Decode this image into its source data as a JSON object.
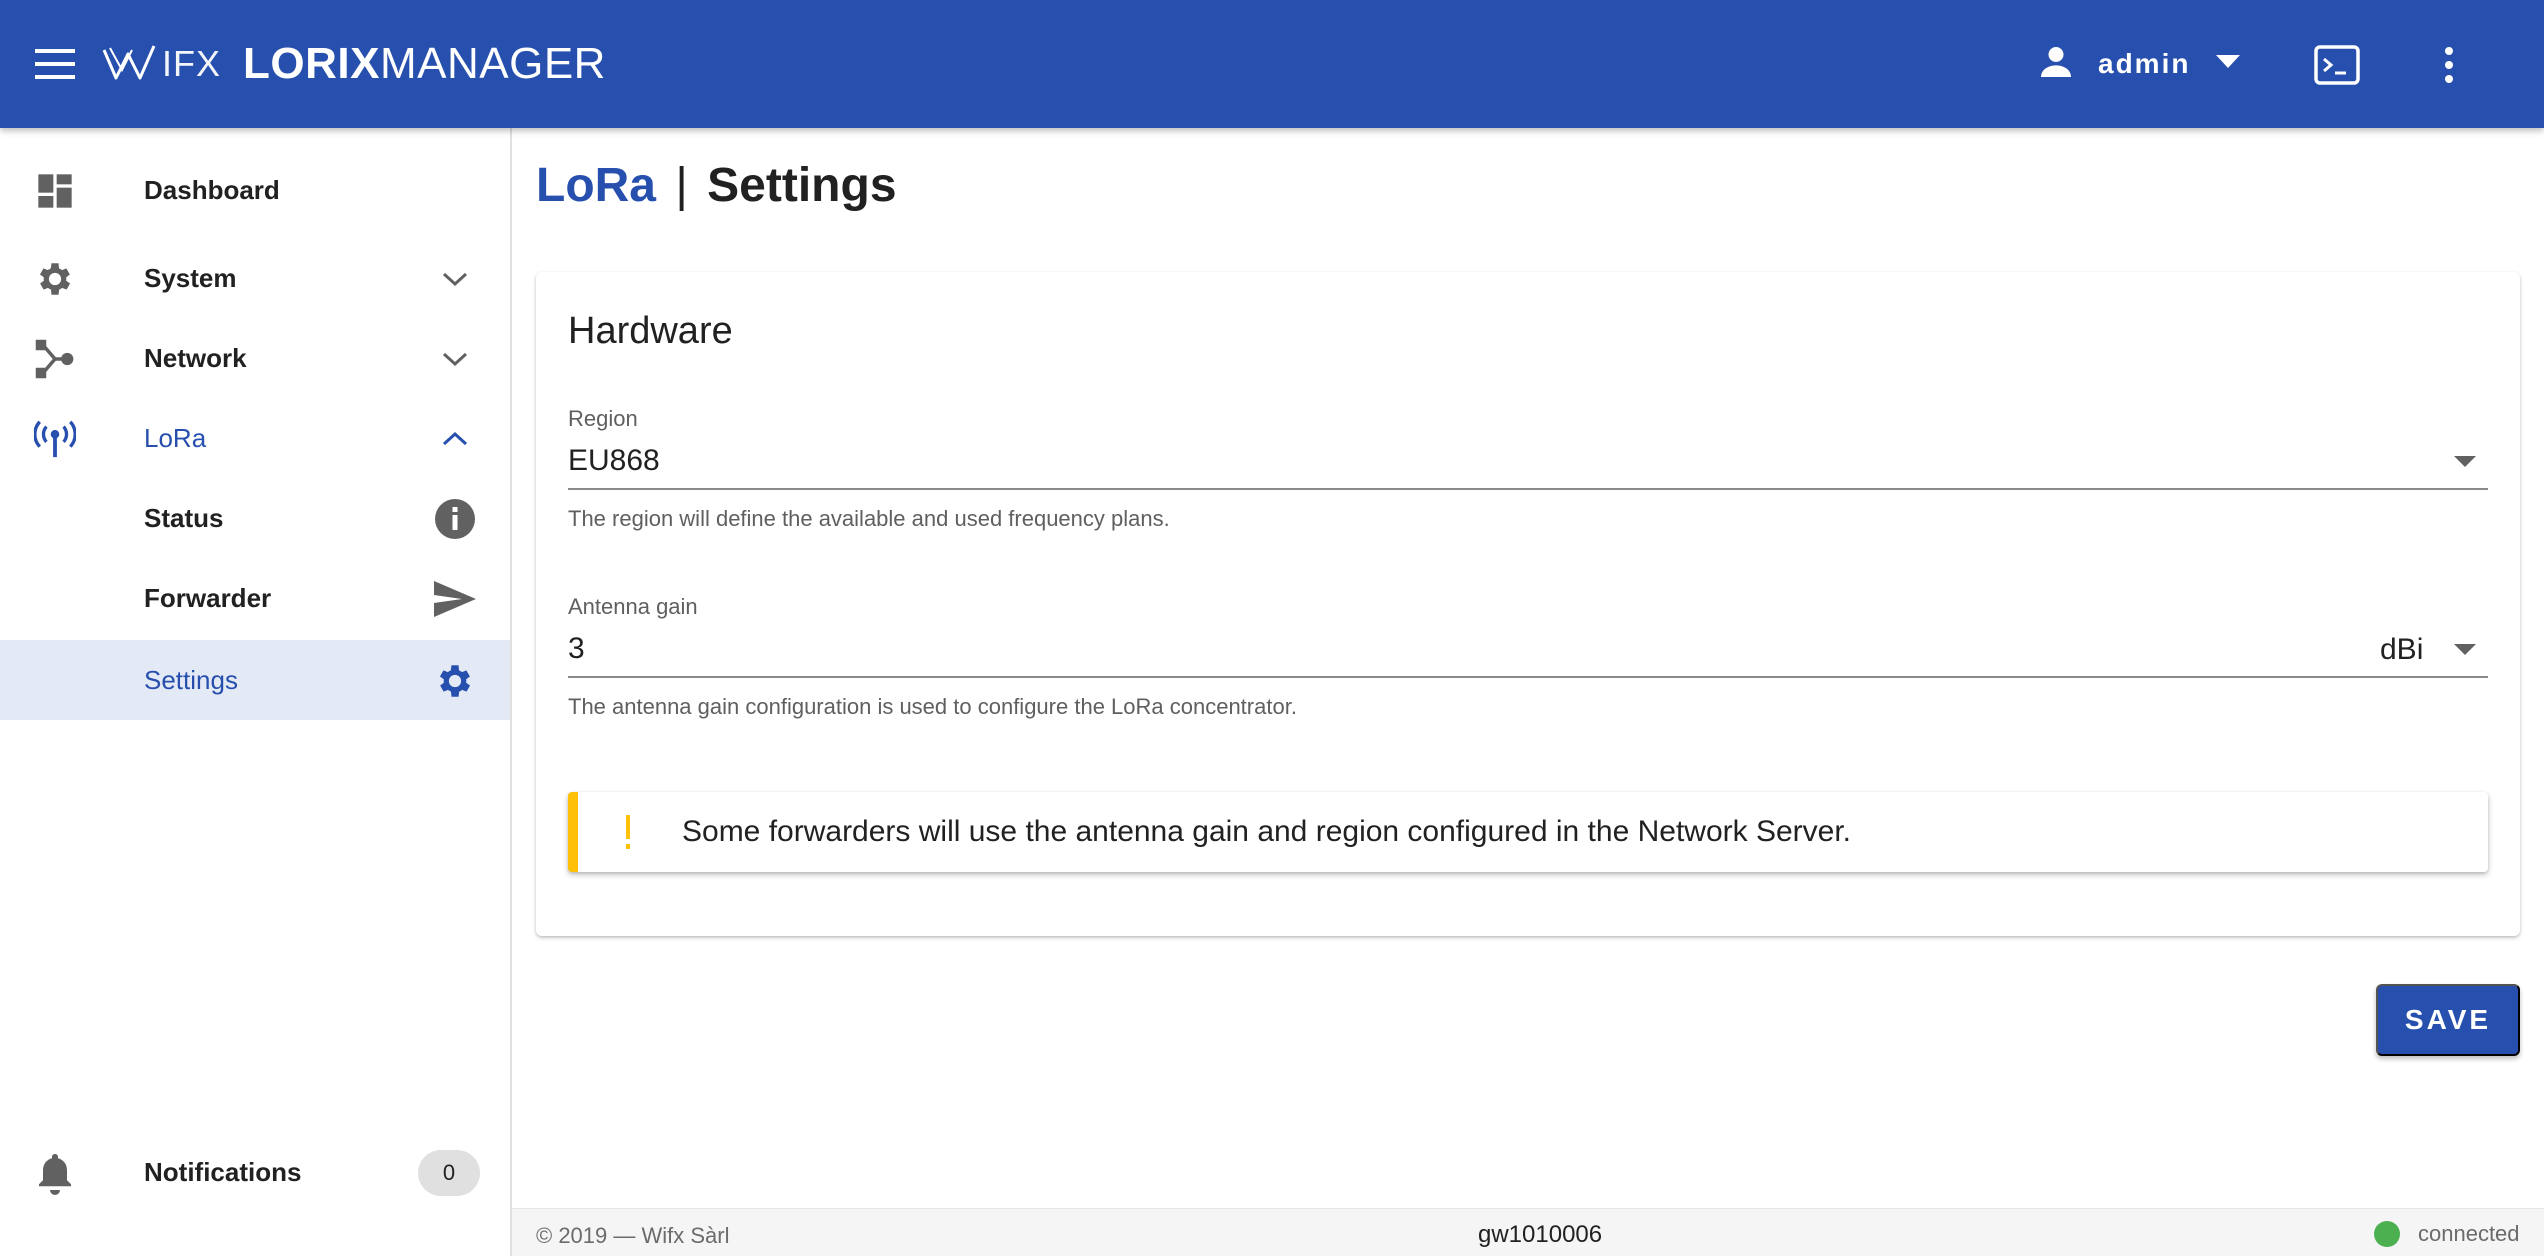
{
  "app": {
    "brand_wifx": "IFX",
    "brand_lorix": "LORIX",
    "brand_manager": "MANAGER"
  },
  "topbar": {
    "user_name": "admin"
  },
  "sidebar": {
    "items": [
      {
        "label": "Dashboard",
        "icon": "dashboard-icon"
      },
      {
        "label": "System",
        "icon": "gear-icon",
        "trail": "chevron-down-icon"
      },
      {
        "label": "Network",
        "icon": "network-icon",
        "trail": "chevron-down-icon"
      },
      {
        "label": "LoRa",
        "icon": "antenna-icon",
        "trail": "chevron-up-icon"
      },
      {
        "label": "Status",
        "icon": "info-icon"
      },
      {
        "label": "Forwarder",
        "icon": "send-icon"
      },
      {
        "label": "Settings",
        "icon": "gear-icon"
      }
    ],
    "notifications": {
      "label": "Notifications",
      "count": "0"
    }
  },
  "page": {
    "breadcrumb": "LoRa",
    "separator": "|",
    "title": "Settings"
  },
  "hardware": {
    "title": "Hardware",
    "region": {
      "label": "Region",
      "value": "EU868",
      "hint": "The region will define the available and used frequency plans."
    },
    "antenna_gain": {
      "label": "Antenna gain",
      "value": "3",
      "unit": "dBi",
      "hint": "The antenna gain configuration is used to configure the LoRa concentrator."
    },
    "alert": {
      "icon": "!",
      "text": "Some forwarders will use the antenna gain and region configured in the Network Server."
    }
  },
  "actions": {
    "save_label": "SAVE"
  },
  "footer": {
    "copyright": "© 2019 — Wifx Sàrl",
    "hostname": "gw1010006",
    "status": "connected"
  },
  "colors": {
    "primary": "#2750ae",
    "warning": "#ffc107",
    "connected": "#4caf50",
    "selected_bg": "#e4e9f6"
  }
}
